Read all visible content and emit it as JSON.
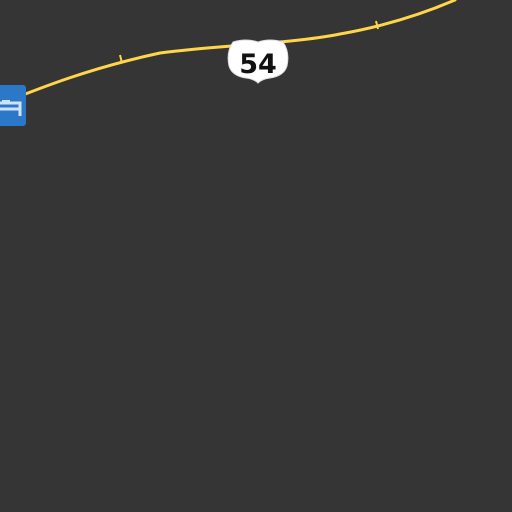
{
  "map": {
    "background_color": "#353535",
    "road_color": "#ffd54a",
    "highway": {
      "route_number": "54",
      "shield_icon": "us-highway-shield-icon"
    },
    "poi_marker": {
      "icon": "lodging-bed-icon",
      "color": "#2c78c8"
    }
  }
}
